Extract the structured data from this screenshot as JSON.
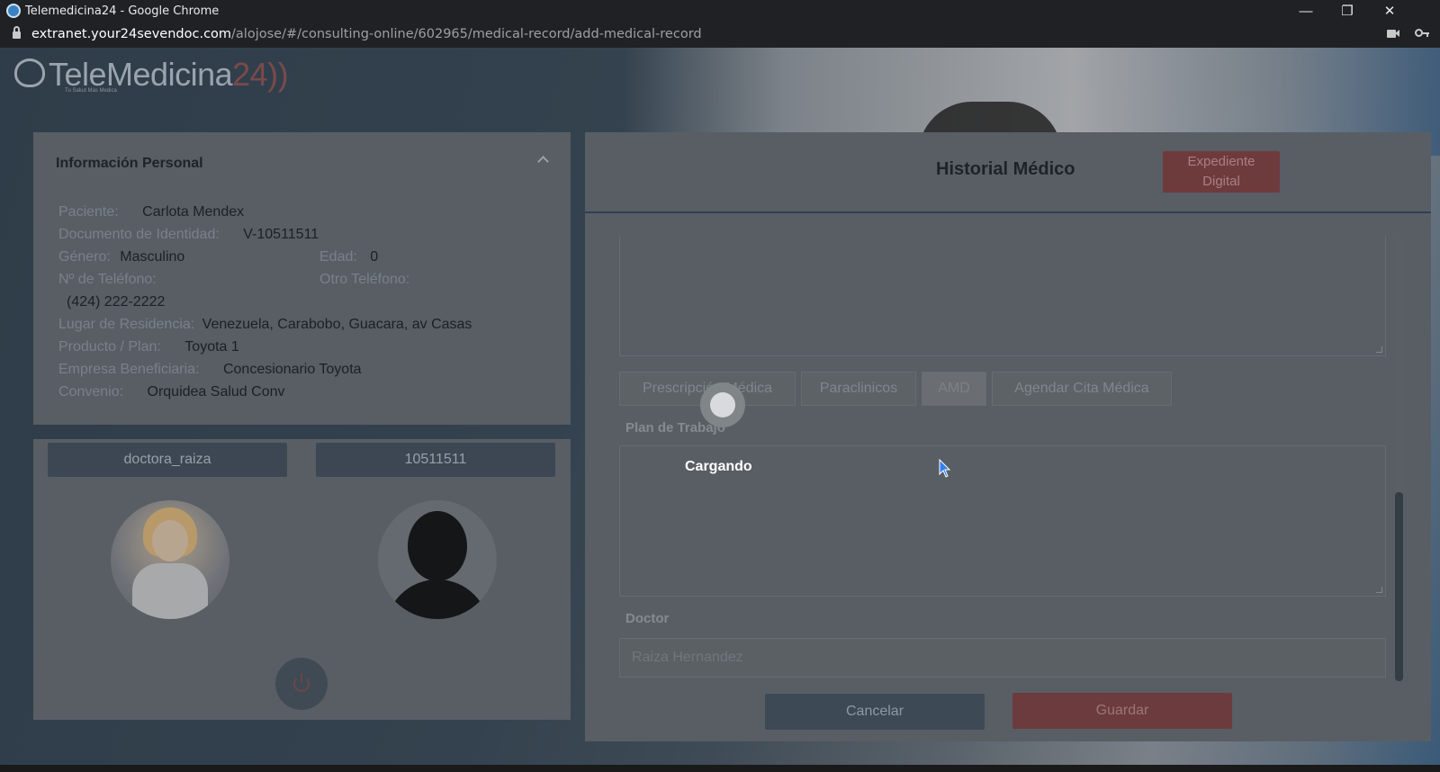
{
  "browser": {
    "window_title": "Telemedicina24 - Google Chrome",
    "url_host": "extranet.your24sevendoc.com",
    "url_path": "/alojose/#/consulting-online/602965/medical-record/add-medical-record",
    "minimize": "—",
    "restore": "❐",
    "close": "✕"
  },
  "logo": {
    "text": "TeleMedicina",
    "number": "24",
    "tagline": "Tu Salud Más Medica"
  },
  "personal_info": {
    "title": "Información Personal",
    "patient_label": "Paciente:",
    "patient_value": "Carlota Mendex",
    "id_label": "Documento de Identidad:",
    "id_value": "V-10511511",
    "gender_label": "Género:",
    "gender_value": "Masculino",
    "age_label": "Edad:",
    "age_value": "0",
    "phone_label": "Nº de Teléfono:",
    "other_phone_label": "Otro Teléfono:",
    "phone_value": "(424) 222-2222",
    "residence_label": "Lugar de Residencia:",
    "residence_value": "Venezuela, Carabobo, Guacara, av Casas",
    "plan_label": "Producto / Plan:",
    "plan_value": "Toyota 1",
    "company_label": "Empresa Beneficiaria:",
    "company_value": "Concesionario Toyota",
    "agreement_label": "Convenio:",
    "agreement_value": "Orquidea Salud Conv"
  },
  "video": {
    "doctor_user": "doctora_raiza",
    "patient_id": "10511511"
  },
  "medical_history": {
    "title": "Historial Médico",
    "digital_record_line1": "Expediente",
    "digital_record_line2": "Digital",
    "tabs": [
      "Prescripción Médica",
      "Paraclinicos",
      "AMD",
      "Agendar Cita Médica"
    ],
    "work_plan_label": "Plan de Trabajo",
    "doctor_label": "Doctor",
    "doctor_value": "Raiza Hernandez",
    "cancel_label": "Cancelar",
    "save_label": "Guardar"
  },
  "loading": {
    "text": "Cargando"
  },
  "colors": {
    "accent_red": "#c0392b",
    "navy": "#1f3a5a"
  }
}
